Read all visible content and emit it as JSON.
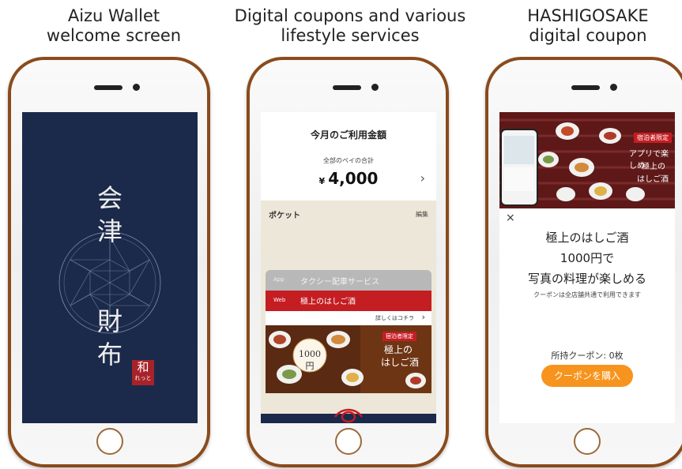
{
  "captions": {
    "left": [
      "Aizu Wallet",
      "welcome screen"
    ],
    "middle": [
      "Digital coupons and various",
      "lifestyle services"
    ],
    "right": [
      "HASHIGOSAKE",
      "digital coupon"
    ]
  },
  "colors": {
    "phone_frame": "#8a4b1c",
    "navy": "#1b2a4a",
    "coupon_red": "#c41d22",
    "button_orange": "#f7941d"
  },
  "welcome": {
    "kanji": [
      "会",
      "津",
      "財",
      "布"
    ],
    "seal_main": "和",
    "seal_sub": "れっと"
  },
  "wallet": {
    "title": "今月のご利用金額",
    "subtitle": "全部のペイの合計",
    "currency": "¥",
    "amount": "4,000",
    "pocket_label": "ポケット",
    "edit_label": "編集",
    "taxi_tag": "App",
    "taxi_name": "タクシー配車サービス",
    "web_tag": "Web",
    "web_name": "極上のはしご酒",
    "detail_link": "詳しくはコチラ",
    "banner": {
      "price": "1000円",
      "badge": "宿泊者限定",
      "title_1": "極上の",
      "title_2": "はしご酒"
    }
  },
  "coupon": {
    "hero": {
      "badge": "宿泊者限定",
      "line1": "アプリで楽しめ",
      "line2": "極上の",
      "line3": "はしご酒"
    },
    "close_icon": "×",
    "line1": "極上のはしご酒",
    "line2": "1000円で",
    "line3": "写真の料理が楽しめる",
    "note": "クーポンは全店舗共通で利用できます",
    "owned": "所持クーポン: 0枚",
    "buy_button": "クーポンを購入"
  }
}
